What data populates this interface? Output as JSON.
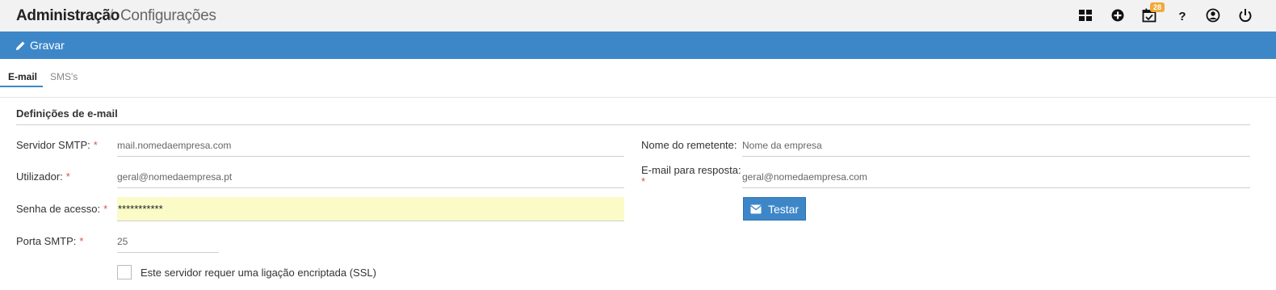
{
  "header": {
    "title": "Administração",
    "separator": "/",
    "subtitle": "Configurações",
    "icons": [
      "dashboard-icon",
      "add-circle-icon",
      "calendar-check-icon",
      "help-icon",
      "user-icon",
      "power-icon"
    ],
    "calendar_badge": "28",
    "badge_color": "#f0a93a"
  },
  "actionbar": {
    "save_label": "Gravar",
    "color": "#3d87c9"
  },
  "tabs": [
    {
      "label": "E-mail",
      "active": true
    },
    {
      "label": "SMS's",
      "active": false
    }
  ],
  "section": {
    "title": "Definições de e-mail"
  },
  "form": {
    "smtp_server": {
      "label": "Servidor SMTP:",
      "required": "*",
      "value": "mail.nomedaempresa.com"
    },
    "username": {
      "label": "Utilizador:",
      "required": "*",
      "value": "geral@nomedaempresa.pt"
    },
    "password": {
      "label": "Senha de acesso:",
      "required": "*",
      "value": "***********"
    },
    "smtp_port": {
      "label": "Porta SMTP:",
      "required": "*",
      "value": "25"
    },
    "ssl": {
      "label": "Este servidor requer uma ligação encriptada (SSL)",
      "checked": false
    },
    "sender_name": {
      "label": "Nome do remetente:",
      "value": "Nome da empresa"
    },
    "reply_email": {
      "label": "E-mail para resposta:",
      "required": "*",
      "value": "geral@nomedaempresa.com"
    },
    "test_label": "Testar"
  }
}
